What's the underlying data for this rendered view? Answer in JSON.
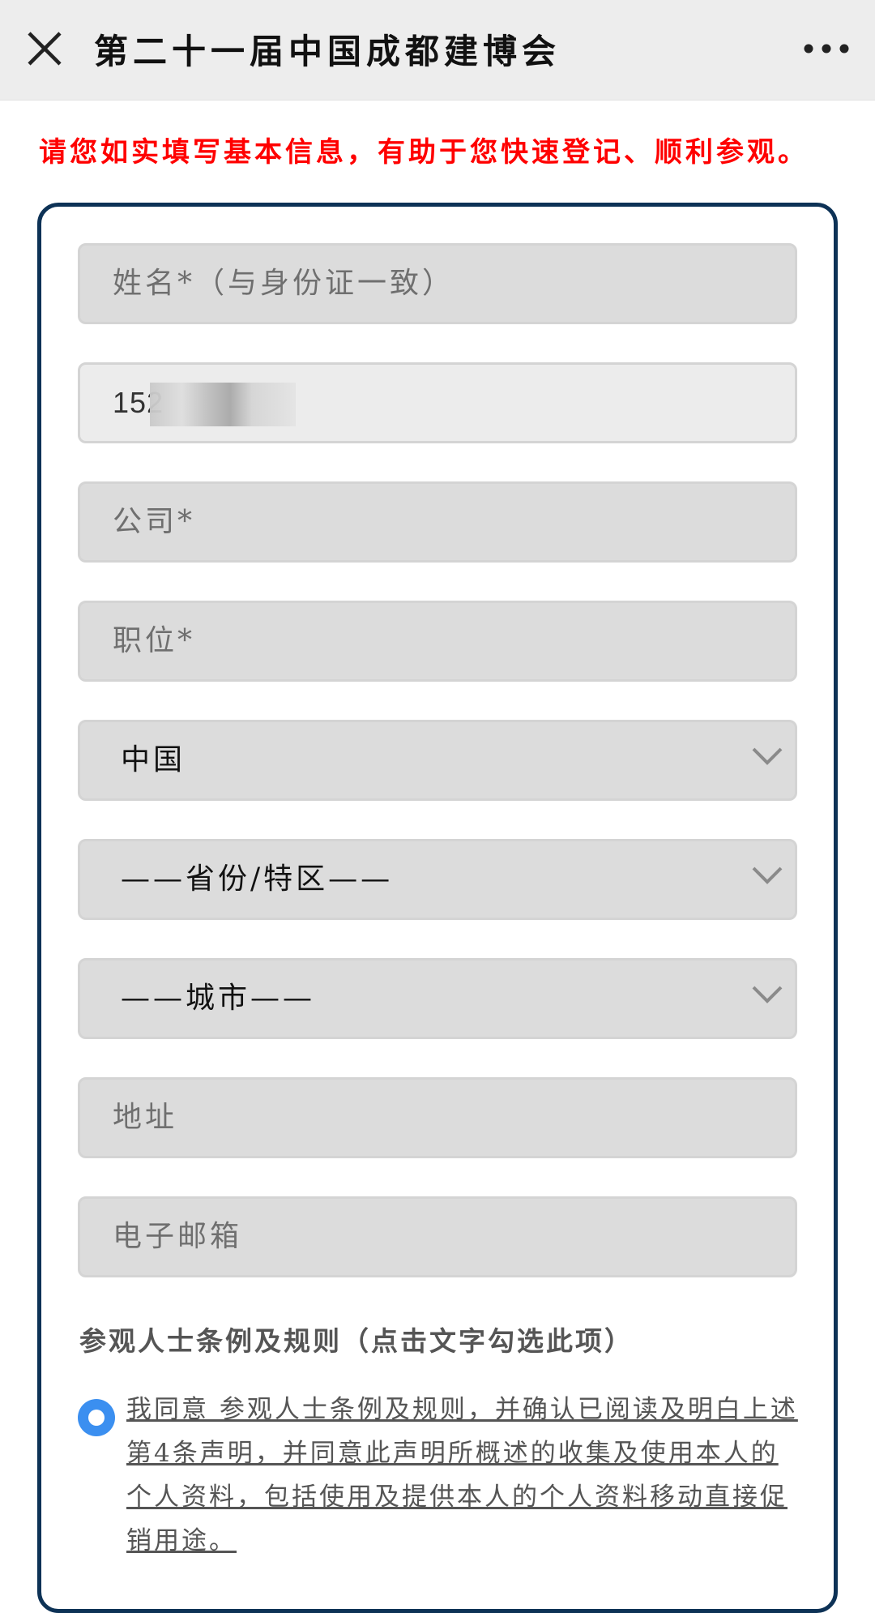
{
  "header": {
    "title": "第二十一届中国成都建博会",
    "close_icon": "close-icon",
    "more_icon": "more-horizontal-icon"
  },
  "notice": "请您如实填写基本信息，有助于您快速登记、顺利参观。",
  "form": {
    "name_placeholder": "姓名*（与身份证一致）",
    "phone_value": "152",
    "company_placeholder": "公司*",
    "position_placeholder": "职位*",
    "country_selected": "中国",
    "province_selected": "——省份/特区——",
    "city_selected": "——城市——",
    "address_placeholder": "地址",
    "email_placeholder": "电子邮箱"
  },
  "rules": {
    "label": "参观人士条例及规则（点击文字勾选此项）",
    "agree_text": "我同意 参观人士条例及规则，并确认已阅读及明白上述第4条声明，并同意此声明所概述的收集及使用本人的个人资料，包括使用及提供本人的个人资料移动直接促销用途。",
    "agreed": true
  },
  "colors": {
    "notice": "#ff0000",
    "card_border": "#0d3256",
    "radio": "#3b8ff0",
    "field_bg": "#dcdcdc"
  }
}
